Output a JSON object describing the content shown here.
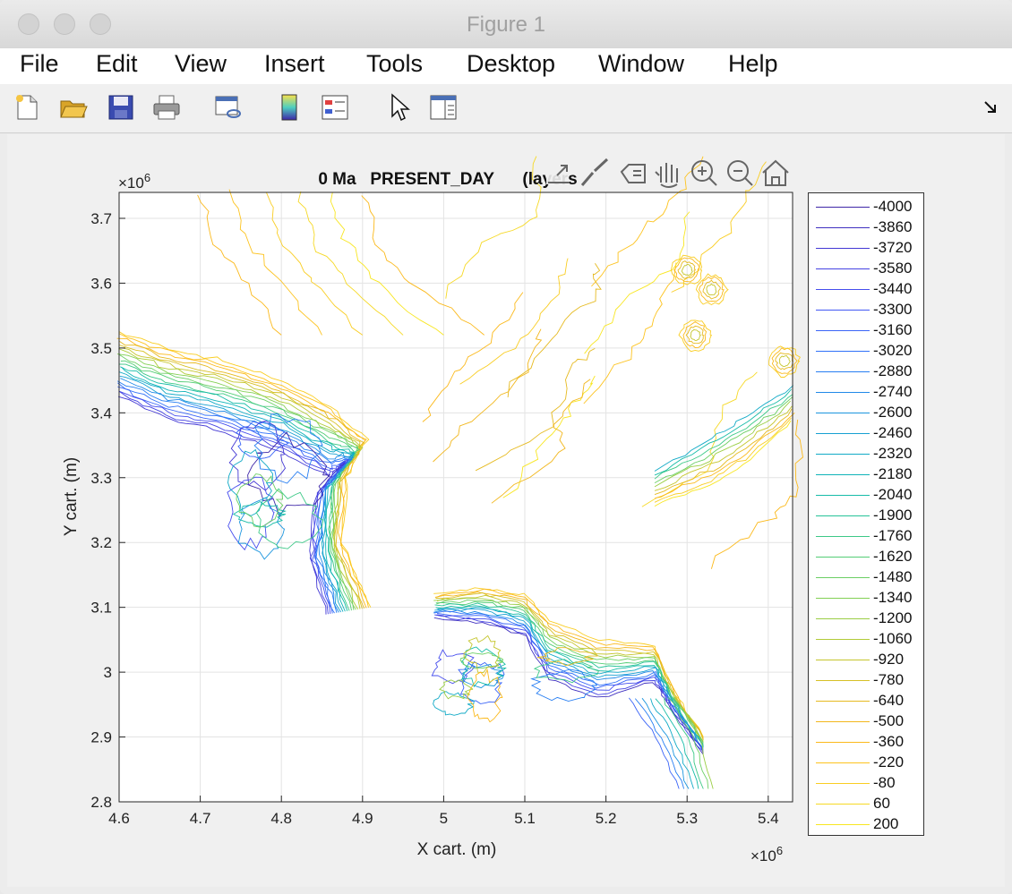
{
  "window": {
    "title": "Figure 1"
  },
  "menu": [
    "File",
    "Edit",
    "View",
    "Insert",
    "Tools",
    "Desktop",
    "Window",
    "Help"
  ],
  "toolbar_icons": [
    "new-figure-icon",
    "open-file-icon",
    "save-icon",
    "print-icon",
    "link-plot-icon",
    "colorbar-icon",
    "legend-icon",
    "pointer-icon",
    "property-editor-icon"
  ],
  "axes_toolbar_icons": [
    "export-icon",
    "brush-icon",
    "data-tips-icon",
    "pan-icon",
    "zoom-in-icon",
    "zoom-out-icon",
    "home-icon"
  ],
  "chart_data": {
    "type": "contour",
    "title": "0 Ma   PRESENT_DAY      (layers",
    "xlabel": "X cart. (m)",
    "ylabel": "Y cart. (m)",
    "x_exponent": "×10",
    "x_exponent_power": "6",
    "y_exponent": "×10",
    "y_exponent_power": "6",
    "xlim": [
      4.6,
      5.43
    ],
    "ylim": [
      2.8,
      3.74
    ],
    "x_ticks": [
      "4.6",
      "4.7",
      "4.8",
      "4.9",
      "5",
      "5.1",
      "5.2",
      "5.3",
      "5.4"
    ],
    "y_ticks": [
      "2.8",
      "2.9",
      "3",
      "3.1",
      "3.2",
      "3.3",
      "3.4",
      "3.5",
      "3.6",
      "3.7"
    ],
    "grid": true,
    "legend_position": "right",
    "levels": [
      -4000,
      -3860,
      -3720,
      -3580,
      -3440,
      -3300,
      -3160,
      -3020,
      -2880,
      -2740,
      -2600,
      -2460,
      -2320,
      -2180,
      -2040,
      -1900,
      -1760,
      -1620,
      -1480,
      -1340,
      -1200,
      -1060,
      -920,
      -780,
      -640,
      -500,
      -360,
      -220,
      -80,
      60,
      200
    ],
    "level_labels": [
      "-4000",
      "-3860",
      "-3720",
      "-3580",
      "-3440",
      "-3300",
      "-3160",
      "-3020",
      "-2880",
      "-2740",
      "-2600",
      "-2460",
      "-2320",
      "-2180",
      "-2040",
      "-1900",
      "-1760",
      "-1620",
      "-1480",
      "-1340",
      "-1200",
      "-1060",
      "-920",
      "-780",
      "-640",
      "-500",
      "-360",
      "-220",
      "-80",
      "60",
      "200"
    ],
    "level_colors": [
      "#3e26a8",
      "#4030c0",
      "#4338d4",
      "#4542e2",
      "#464ded",
      "#4258f4",
      "#3a64f7",
      "#2f71f8",
      "#277ef2",
      "#2189e8",
      "#1b95de",
      "#16a0d2",
      "#11aac6",
      "#10b4b8",
      "#17bca8",
      "#27c398",
      "#3cc987",
      "#53cd76",
      "#6bcf64",
      "#83d054",
      "#9bce45",
      "#b1cb38",
      "#c5c62e",
      "#d7c026",
      "#e6ba20",
      "#f2b71c",
      "#fbb91b",
      "#fdc31e",
      "#f9cd22",
      "#f6d925",
      "#f8e621"
    ]
  }
}
